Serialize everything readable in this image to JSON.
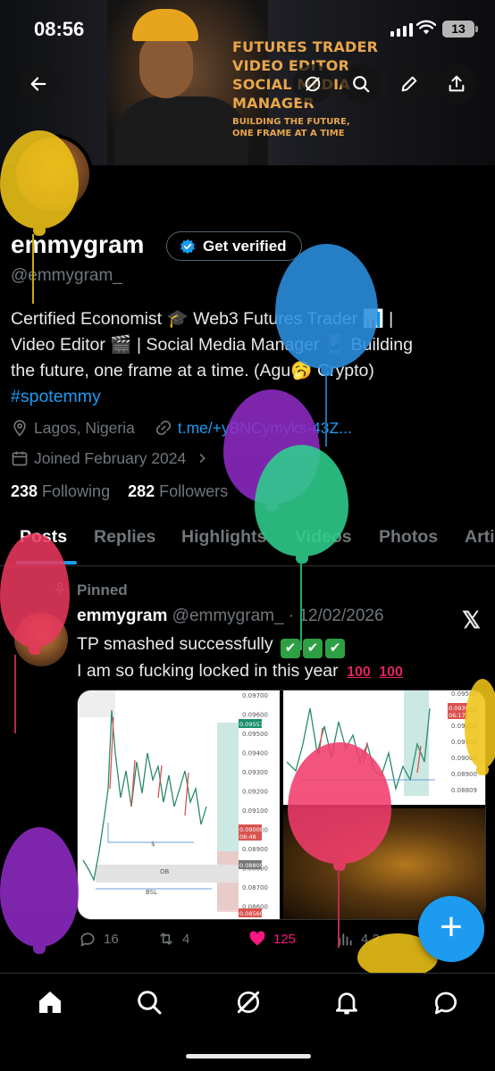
{
  "status_bar": {
    "time": "08:56",
    "battery": "13"
  },
  "banner": {
    "lines": [
      "FUTURES TRADER",
      "VIDEO EDITOR",
      "SOCIAL MEDIA",
      "MANAGER"
    ],
    "sub_lines": [
      "BUILDING THE FUTURE,",
      "ONE FRAME AT A TIME"
    ]
  },
  "profile": {
    "display_name": "emmygram",
    "verify_label": "Get verified",
    "handle": "@emmygram_",
    "bio_line_1": "Certified Economist 🎓 Web3 Futures Trader 📊 |",
    "bio_line_2": "Video Editor 🎬 | Social Media Manager 📱  Building",
    "bio_line_3": "the future, one frame at a time. (Agu🥱 Crypto)",
    "bio_tag": "#spotemmy",
    "location": "Lagos, Nigeria",
    "link": "t.me/+yBNCymyks-43Z...",
    "joined": "Joined February 2024",
    "following_count": "238",
    "following_label": "Following",
    "followers_count": "282",
    "followers_label": "Followers"
  },
  "tabs": [
    {
      "label": "Posts",
      "active": true
    },
    {
      "label": "Replies"
    },
    {
      "label": "Highlights"
    },
    {
      "label": "Videos"
    },
    {
      "label": "Photos"
    },
    {
      "label": "Arti"
    }
  ],
  "post": {
    "pinned_label": "Pinned",
    "author_name": "emmygram",
    "author_handle": "@emmygram_",
    "date": "· 12/02/2026",
    "text_line_1": "TP smashed successfully",
    "text_line_2": "I am so fucking locked in this year",
    "hundred": "100",
    "chart1_ticks": [
      "0.09700",
      "0.09600",
      "0.09500",
      "0.09400",
      "0.09300",
      "0.09200",
      "0.09100",
      "0.09000",
      "0.08900",
      "0.08800",
      "0.08700",
      "0.08600"
    ],
    "chart1_labels": {
      "ob": "OB",
      "bsl": "BSL",
      "dollar": "$"
    },
    "chart1_price_tags": [
      "0.09557",
      "0.09009",
      "08:48",
      "0.08809",
      "0.08560"
    ],
    "chart2_ticks": [
      "0.09500",
      "0.09300",
      "0.09200",
      "0.09100",
      "0.09000",
      "0.08900",
      "0.08809"
    ],
    "chart2_price_tags": [
      "0.0939",
      "06:17"
    ],
    "replies": "16",
    "reposts": "4",
    "likes": "125",
    "views": "4.2"
  },
  "colors": {
    "accent": "#1d9bf0",
    "like": "#f91880",
    "muted": "#71767b",
    "banner_text": "#e8a64a"
  },
  "icons": {
    "back": "arrow-left-icon",
    "grok": "grok-icon",
    "search": "search-icon",
    "edit": "pencil-icon",
    "share": "share-icon",
    "location": "location-pin-icon",
    "link": "link-icon",
    "calendar": "calendar-icon",
    "fab": "plus-icon"
  }
}
